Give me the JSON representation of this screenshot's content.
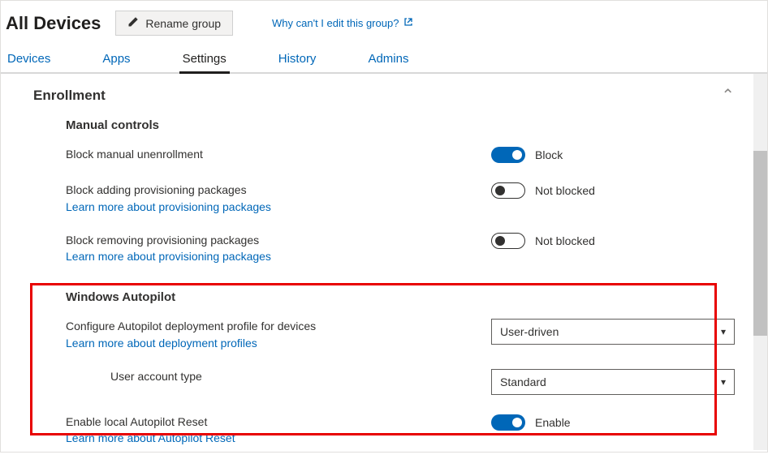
{
  "header": {
    "title": "All Devices",
    "rename_label": "Rename group",
    "edit_link": "Why can't I edit this group?"
  },
  "tabs": [
    "Devices",
    "Apps",
    "Settings",
    "History",
    "Admins"
  ],
  "active_tab_index": 2,
  "section": {
    "title": "Enrollment",
    "manual": {
      "title": "Manual controls",
      "block_unenroll": {
        "label": "Block manual unenrollment",
        "state": "Block",
        "on": true
      },
      "block_add_pkg": {
        "label": "Block adding provisioning packages",
        "link": "Learn more about provisioning packages",
        "state": "Not blocked",
        "on": false
      },
      "block_rm_pkg": {
        "label": "Block removing provisioning packages",
        "link": "Learn more about provisioning packages",
        "state": "Not blocked",
        "on": false
      }
    },
    "autopilot": {
      "title": "Windows Autopilot",
      "profile": {
        "label": "Configure Autopilot deployment profile for devices",
        "link": "Learn more about deployment profiles",
        "value": "User-driven"
      },
      "account_type": {
        "label": "User account type",
        "value": "Standard"
      },
      "reset": {
        "label": "Enable local Autopilot Reset",
        "link": "Learn more about Autopilot Reset",
        "state": "Enable",
        "on": true
      }
    }
  }
}
